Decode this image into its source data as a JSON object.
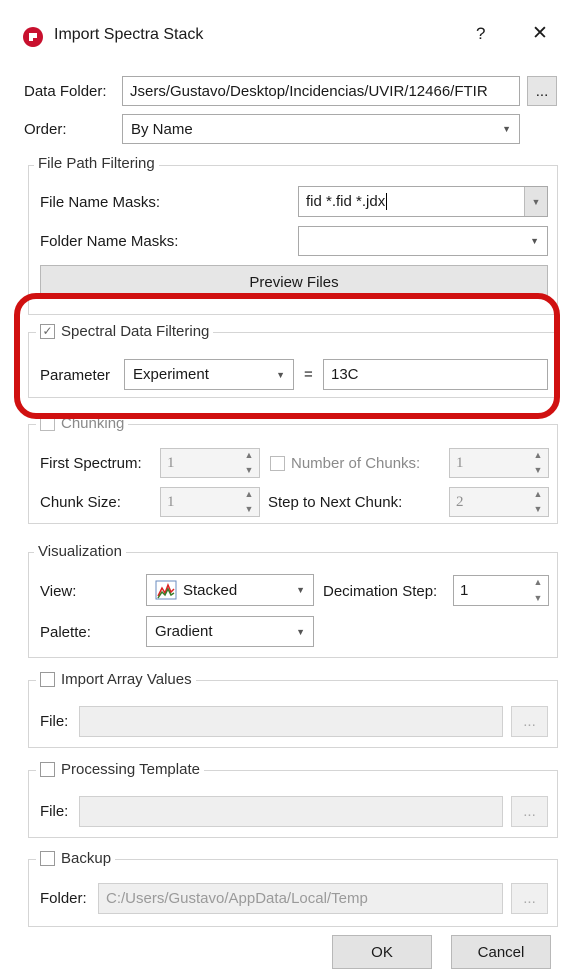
{
  "window": {
    "title": "Import Spectra Stack",
    "help_glyph": "?",
    "close_glyph": "✕",
    "app_icon": "app-logo-icon"
  },
  "data_folder": {
    "label": "Data Folder:",
    "value": "Jsers/Gustavo/Desktop/Incidencias/UVIR/12466/FTIR",
    "browse": "..."
  },
  "order": {
    "label": "Order:",
    "value": "By Name"
  },
  "file_path_filtering": {
    "title": "File Path Filtering",
    "file_name_masks_label": "File Name Masks:",
    "file_name_masks_value": "fid *.fid *.jdx",
    "folder_name_masks_label": "Folder Name Masks:",
    "folder_name_masks_value": "",
    "preview_button": "Preview Files"
  },
  "spectral_data_filtering": {
    "title": "Spectral Data Filtering",
    "checked": true,
    "parameter_label": "Parameter",
    "parameter_value": "Experiment",
    "equals": "=",
    "value": "13C",
    "highlight_color": "#d01010"
  },
  "chunking": {
    "title": "Chunking",
    "first_spectrum_label": "First Spectrum:",
    "first_spectrum_value": "1",
    "number_of_chunks_label": "Number of Chunks:",
    "number_of_chunks_value": "1",
    "chunk_size_label": "Chunk Size:",
    "chunk_size_value": "1",
    "step_label": "Step to Next Chunk:",
    "step_value": "2"
  },
  "visualization": {
    "title": "Visualization",
    "view_label": "View:",
    "view_value": "Stacked",
    "decimation_label": "Decimation Step:",
    "decimation_value": "1",
    "palette_label": "Palette:",
    "palette_value": "Gradient"
  },
  "import_array_values": {
    "title": "Import Array Values",
    "file_label": "File:",
    "file_value": "",
    "browse": "..."
  },
  "processing_template": {
    "title": "Processing Template",
    "file_label": "File:",
    "file_value": "",
    "browse": "..."
  },
  "backup": {
    "title": "Backup",
    "folder_label": "Folder:",
    "folder_value": "C:/Users/Gustavo/AppData/Local/Temp",
    "browse": "..."
  },
  "buttons": {
    "ok": "OK",
    "cancel": "Cancel"
  }
}
